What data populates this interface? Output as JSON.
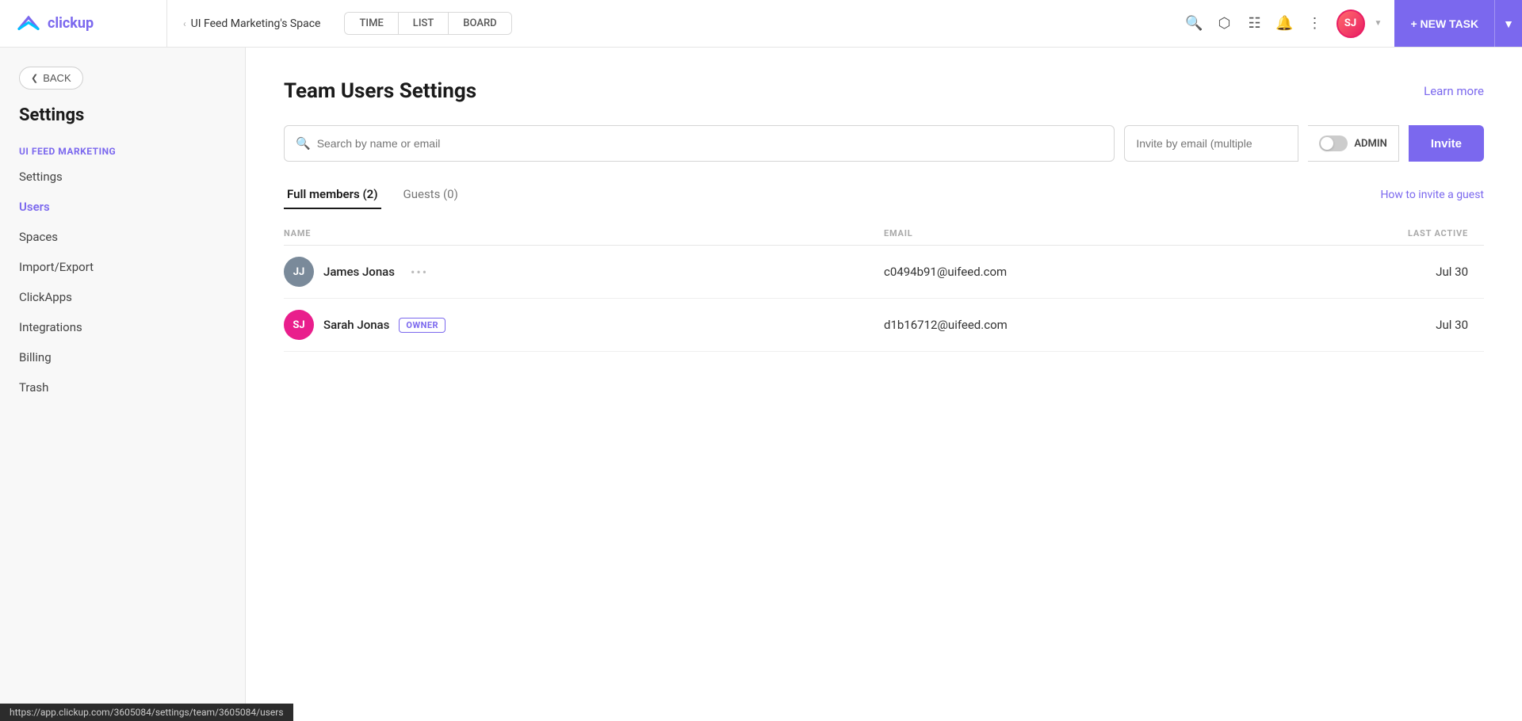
{
  "topnav": {
    "logo_text": "clickup",
    "breadcrumb_arrow": "‹",
    "breadcrumb_text": "UI Feed Marketing's Space",
    "tabs": [
      {
        "label": "TIME"
      },
      {
        "label": "LIST"
      },
      {
        "label": "BOARD"
      }
    ],
    "new_task_label": "+ NEW TASK",
    "avatar_initials": "SJ"
  },
  "sidebar": {
    "back_label": "BACK",
    "title": "Settings",
    "section_title": "UI FEED MARKETING",
    "items": [
      {
        "label": "Settings",
        "active": false
      },
      {
        "label": "Users",
        "active": true
      },
      {
        "label": "Spaces",
        "active": false
      },
      {
        "label": "Import/Export",
        "active": false
      },
      {
        "label": "ClickApps",
        "active": false
      },
      {
        "label": "Integrations",
        "active": false
      },
      {
        "label": "Billing",
        "active": false
      },
      {
        "label": "Trash",
        "active": false
      }
    ]
  },
  "content": {
    "page_title": "Team Users Settings",
    "learn_more": "Learn more",
    "search_placeholder": "Search by name or email",
    "invite_placeholder": "Invite by email (multiple",
    "admin_label": "ADMIN",
    "invite_btn": "Invite",
    "tabs": [
      {
        "label": "Full members (2)",
        "active": true
      },
      {
        "label": "Guests (0)",
        "active": false
      }
    ],
    "how_to_invite": "How to invite a guest",
    "table": {
      "col_name": "NAME",
      "col_email": "EMAIL",
      "col_last_active": "LAST ACTIVE",
      "rows": [
        {
          "initials": "JJ",
          "avatar_color": "#7a8a9a",
          "name": "James Jonas",
          "show_dots": true,
          "is_owner": false,
          "email": "c0494b91@uifeed.com",
          "last_active": "Jul 30"
        },
        {
          "initials": "SJ",
          "avatar_color": "#e91e8c",
          "name": "Sarah Jonas",
          "show_dots": false,
          "is_owner": true,
          "email": "d1b16712@uifeed.com",
          "last_active": "Jul 30"
        }
      ]
    }
  },
  "statusbar": {
    "url": "https://app.clickup.com/3605084/settings/team/3605084/users"
  }
}
